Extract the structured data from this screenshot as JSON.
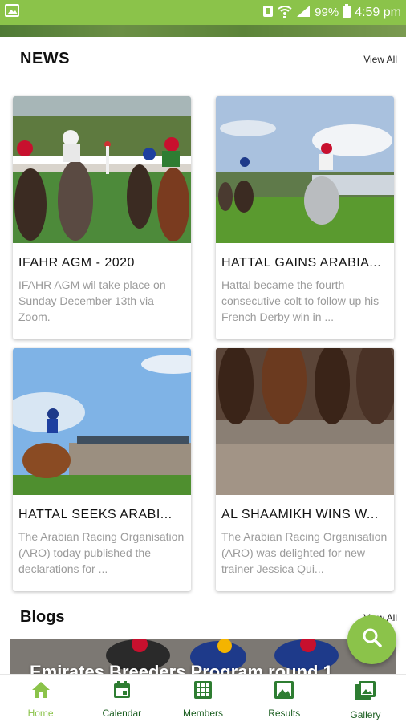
{
  "status_bar": {
    "battery": "99%",
    "time": "4:59 pm",
    "icons": [
      "image-icon",
      "nfc-icon",
      "wifi-icon",
      "signal-icon",
      "battery-icon"
    ]
  },
  "news": {
    "title": "NEWS",
    "view_all": "View All",
    "cards": [
      {
        "title": "IFAHR AGM - 2020",
        "excerpt": "IFAHR AGM wil take place on Sunday December 13th via Zoom."
      },
      {
        "title": "HATTAL GAINS ARABIA...",
        "excerpt": "Hattal became the fourth consecutive colt to follow up his French Derby win in ..."
      },
      {
        "title": "HATTAL SEEKS ARABI...",
        "excerpt": "The Arabian Racing Organ­isation (ARO) today pub­lished the declarations for ..."
      },
      {
        "title": "AL SHAAMIKH WINS W...",
        "excerpt": "The Arabian Racing Organ­isation (ARO) was delighted for new trainer Jessica Qui..."
      }
    ]
  },
  "blogs": {
    "title": "Blogs",
    "view_all": "View All",
    "banner_title": "Emirates Breeders Program round 1"
  },
  "fab": {
    "icon": "search-icon"
  },
  "bottom_nav": {
    "items": [
      {
        "label": "Home",
        "icon": "home-icon",
        "active": true
      },
      {
        "label": "Calendar",
        "icon": "calendar-icon",
        "active": false
      },
      {
        "label": "Members",
        "icon": "grid-icon",
        "active": false
      },
      {
        "label": "Results",
        "icon": "image-icon",
        "active": false
      },
      {
        "label": "Gallery",
        "icon": "gallery-icon",
        "active": false
      }
    ]
  },
  "colors": {
    "accent": "#8bc34a",
    "nav_label": "#1b5e20",
    "excerpt": "#9b9b9b"
  }
}
